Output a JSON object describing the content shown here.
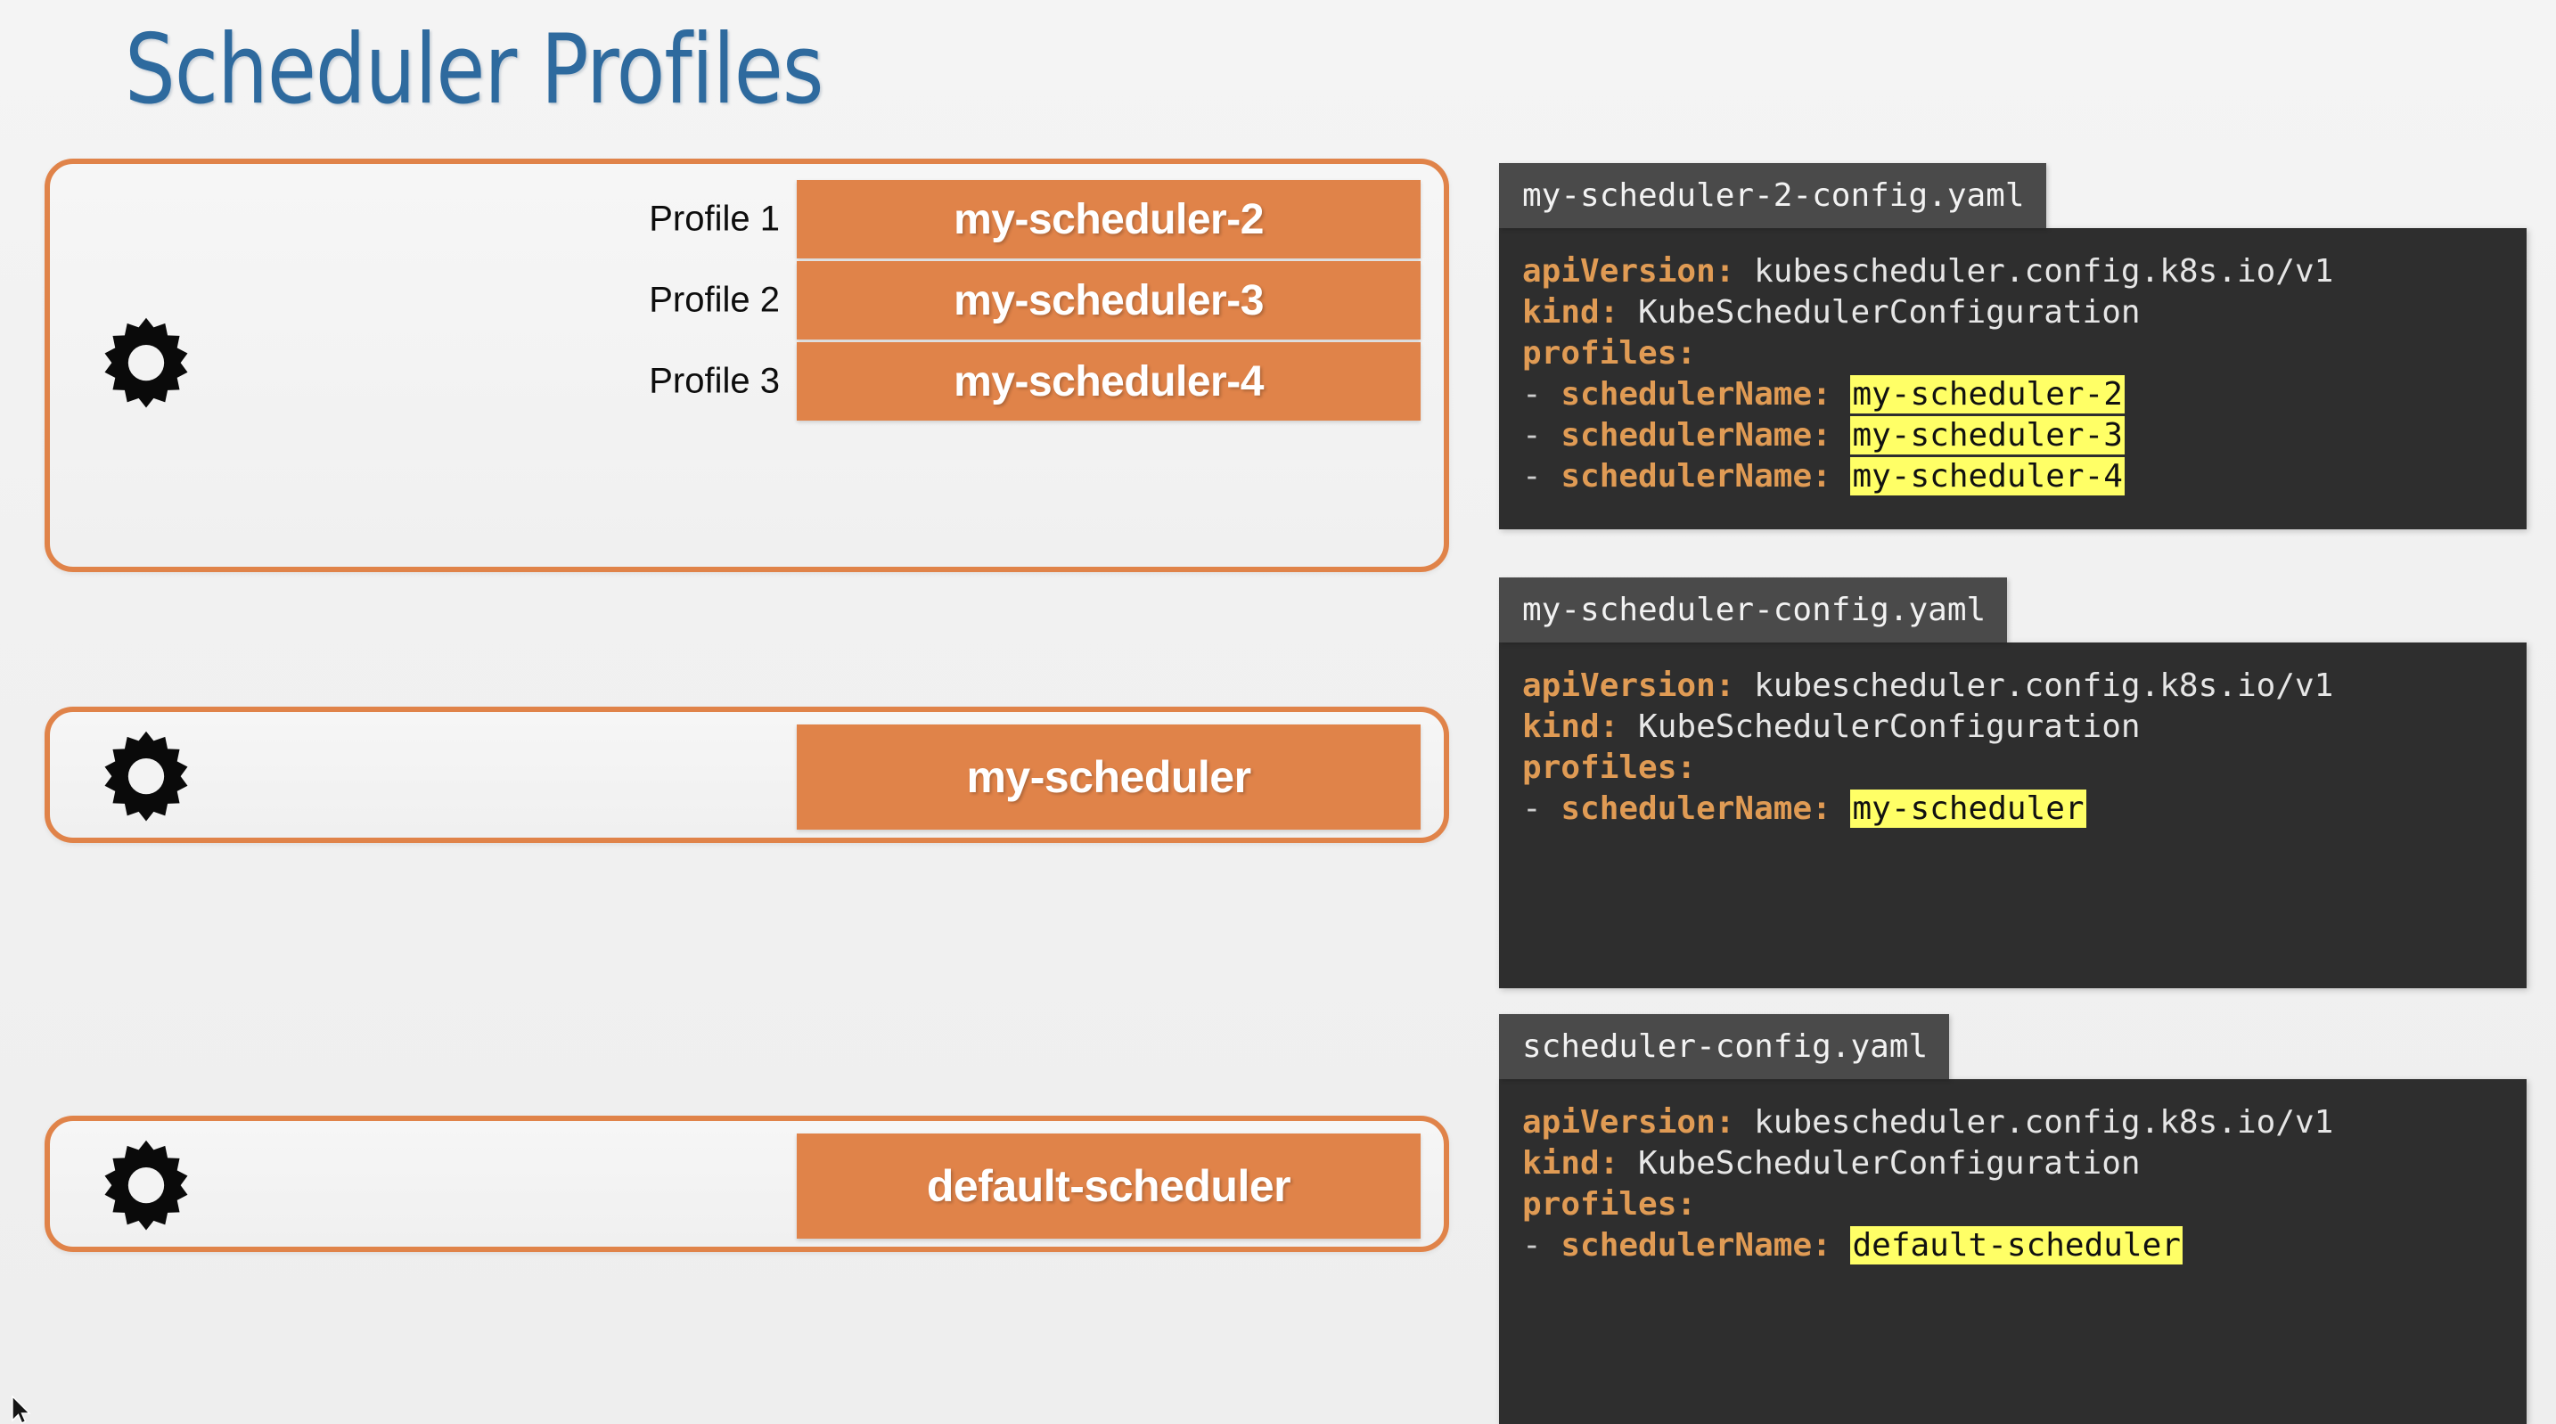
{
  "title": "Scheduler Profiles",
  "theme": {
    "background": "#f1f1f1",
    "title_color": "#2e6a9e",
    "accent_orange": "#e08349",
    "code_bg": "#2e2e2e",
    "code_tab_bg": "#4a4a4a",
    "code_key_color": "#e09b54",
    "highlight_bg": "#ffff66"
  },
  "panels": [
    {
      "id": "profiles",
      "icon": "gear-icon",
      "rows": [
        {
          "label": "Profile 1",
          "scheduler": "my-scheduler-2"
        },
        {
          "label": "Profile 2",
          "scheduler": "my-scheduler-3"
        },
        {
          "label": "Profile 3",
          "scheduler": "my-scheduler-4"
        }
      ]
    },
    {
      "id": "my-scheduler",
      "icon": "gear-icon",
      "scheduler": "my-scheduler"
    },
    {
      "id": "default-scheduler",
      "icon": "gear-icon",
      "scheduler": "default-scheduler"
    }
  ],
  "code_blocks": [
    {
      "filename": "my-scheduler-2-config.yaml",
      "lines": [
        {
          "key": "apiVersion:",
          "value": " kubescheduler.config.k8s.io/v1"
        },
        {
          "key": "kind:",
          "value": " KubeSchedulerConfiguration"
        },
        {
          "key": "profiles:",
          "value": ""
        },
        {
          "dash": "- ",
          "key": "schedulerName:",
          "value": " ",
          "highlight": "my-scheduler-2"
        },
        {
          "dash": "- ",
          "key": "schedulerName:",
          "value": " ",
          "highlight": "my-scheduler-3"
        },
        {
          "dash": "- ",
          "key": "schedulerName:",
          "value": " ",
          "highlight": "my-scheduler-4"
        }
      ]
    },
    {
      "filename": "my-scheduler-config.yaml",
      "lines": [
        {
          "key": "apiVersion:",
          "value": " kubescheduler.config.k8s.io/v1"
        },
        {
          "key": "kind:",
          "value": " KubeSchedulerConfiguration"
        },
        {
          "key": "profiles:",
          "value": ""
        },
        {
          "dash": "- ",
          "key": "schedulerName:",
          "value": " ",
          "highlight": "my-scheduler"
        }
      ]
    },
    {
      "filename": "scheduler-config.yaml",
      "lines": [
        {
          "key": "apiVersion:",
          "value": " kubescheduler.config.k8s.io/v1"
        },
        {
          "key": "kind:",
          "value": " KubeSchedulerConfiguration"
        },
        {
          "key": "profiles:",
          "value": ""
        },
        {
          "dash": "- ",
          "key": "schedulerName:",
          "value": " ",
          "highlight": "default-scheduler"
        }
      ]
    }
  ]
}
